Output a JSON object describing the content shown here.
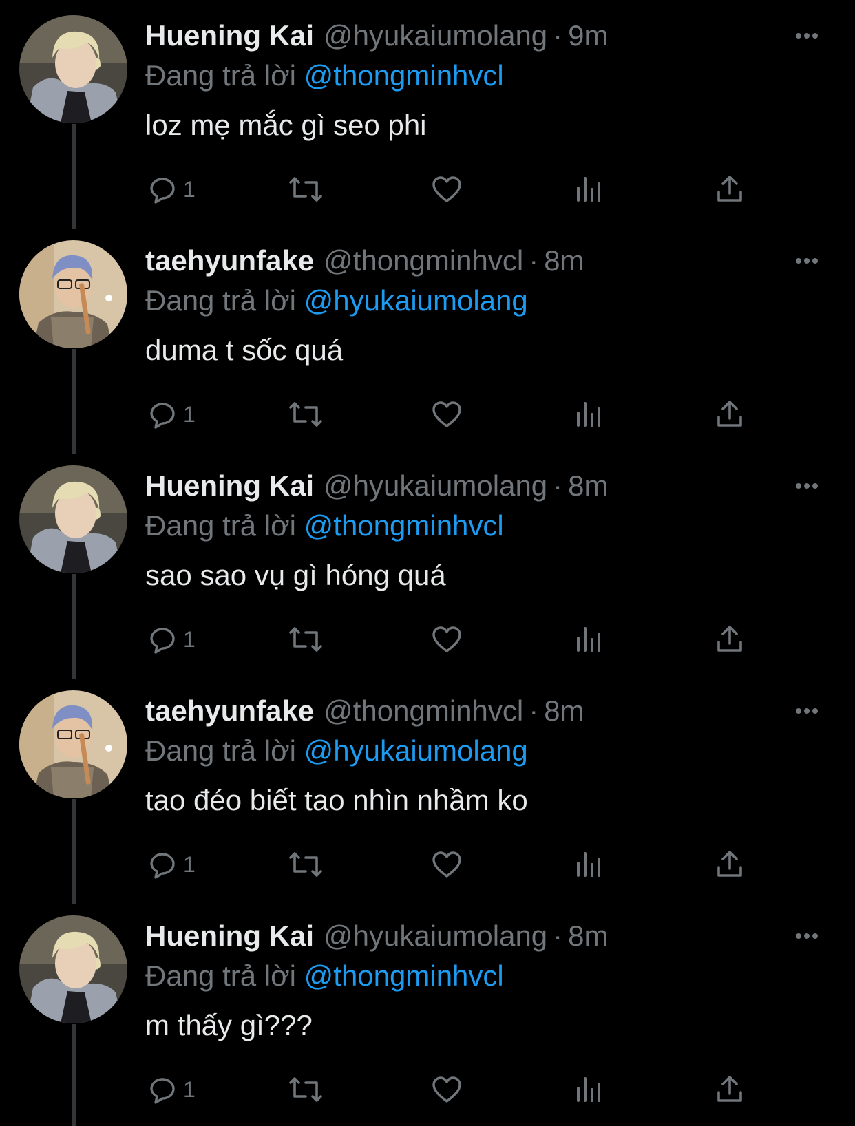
{
  "colors": {
    "background": "#000000",
    "primary_text": "#e7e9ea",
    "secondary_text": "#71767b",
    "accent": "#1d9bf0",
    "thread_line": "#333639"
  },
  "icons": {
    "reply": "reply-icon",
    "retweet": "retweet-icon",
    "like": "heart-icon",
    "views": "analytics-icon",
    "share": "share-icon",
    "more": "more-icon"
  },
  "tweets": [
    {
      "name": "Huening Kai",
      "handle": "@hyukaiumolang",
      "separator": "·",
      "time": "9m",
      "reply_prefix": "Đang trả lời",
      "reply_to": "@thongminhvcl",
      "text": "loz mẹ mắc gì seo phi",
      "reply_count": "1",
      "avatar": "huening-kai-avatar"
    },
    {
      "name": "taehyunfake",
      "handle": "@thongminhvcl",
      "separator": "·",
      "time": "8m",
      "reply_prefix": "Đang trả lời",
      "reply_to": "@hyukaiumolang",
      "text": "duma t sốc quá",
      "reply_count": "1",
      "avatar": "taehyunfake-avatar"
    },
    {
      "name": "Huening Kai",
      "handle": "@hyukaiumolang",
      "separator": "·",
      "time": "8m",
      "reply_prefix": "Đang trả lời",
      "reply_to": "@thongminhvcl",
      "text": "sao sao vụ gì hóng quá",
      "reply_count": "1",
      "avatar": "huening-kai-avatar"
    },
    {
      "name": "taehyunfake",
      "handle": "@thongminhvcl",
      "separator": "·",
      "time": "8m",
      "reply_prefix": "Đang trả lời",
      "reply_to": "@hyukaiumolang",
      "text": "tao đéo biết tao nhìn nhầm ko",
      "reply_count": "1",
      "avatar": "taehyunfake-avatar"
    },
    {
      "name": "Huening Kai",
      "handle": "@hyukaiumolang",
      "separator": "·",
      "time": "8m",
      "reply_prefix": "Đang trả lời",
      "reply_to": "@thongminhvcl",
      "text": "m thấy gì???",
      "reply_count": "1",
      "avatar": "huening-kai-avatar"
    }
  ]
}
